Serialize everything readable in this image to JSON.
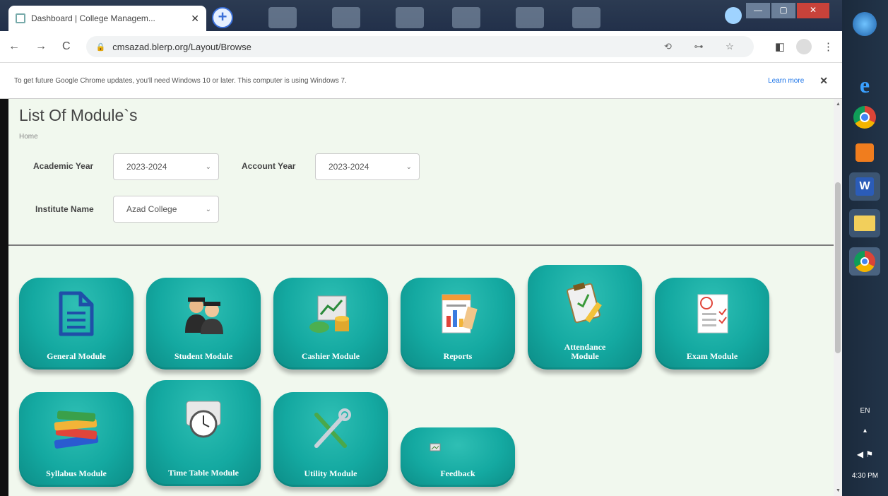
{
  "browser": {
    "tab_title": "Dashboard | College Managem...",
    "tab_close": "✕",
    "new_tab": "+",
    "url": "cmsazad.blerp.org/Layout/Browse",
    "back": "←",
    "forward": "→",
    "reload": "C",
    "lock": "🔒",
    "omni_icons": "⟲ ⊶ ☆",
    "star": "☆",
    "sidebar": "◧",
    "menu": "⋮"
  },
  "infobar": {
    "message": "To get future Google Chrome updates, you'll need Windows 10 or later. This computer is using Windows 7.",
    "learn_more": "Learn more",
    "close": "✕"
  },
  "page": {
    "title": "List Of Module`s",
    "breadcrumb": "Home"
  },
  "filters": {
    "academic_year_label": "Academic Year",
    "academic_year_value": "2023-2024",
    "account_year_label": "Account Year",
    "account_year_value": "2023-2024",
    "institute_label": "Institute Name",
    "institute_value": "Azad College",
    "dropdown_arrow": "⌄"
  },
  "modules": [
    {
      "label": "General Module"
    },
    {
      "label": "Student Module"
    },
    {
      "label": "Cashier Module"
    },
    {
      "label": "Reports"
    },
    {
      "label": "Attendance Module"
    },
    {
      "label": "Exam Module"
    },
    {
      "label": "Syllabus Module"
    },
    {
      "label": "Time Table Module"
    },
    {
      "label": "Utility Module"
    },
    {
      "label": "Feedback"
    }
  ],
  "taskbar": {
    "lang": "EN",
    "time": "4:30 PM"
  },
  "colors": {
    "tile": "#14a9a1",
    "page_bg": "#f1f8ee"
  }
}
